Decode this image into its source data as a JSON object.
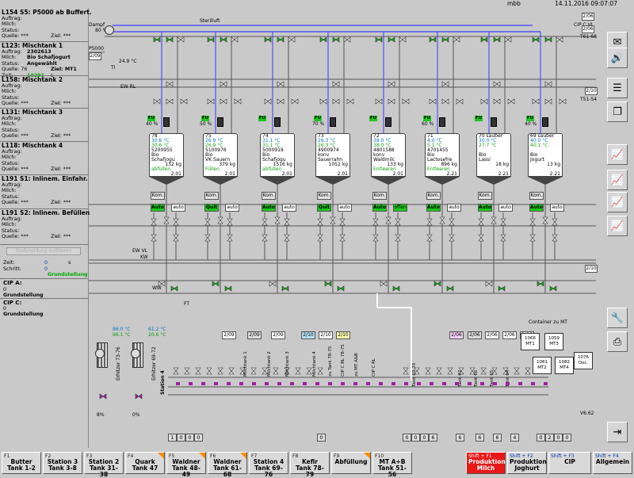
{
  "header": {
    "title": "",
    "user": "mbb",
    "datetime": "14.11.2016 09:07:07"
  },
  "left_panel": [
    {
      "title": "L154 S5: P5000 ab Buffert.",
      "rows": [
        [
          "Auftrag:",
          "",
          ""
        ],
        [
          "Milch:",
          "",
          ""
        ],
        [
          "Status:",
          "",
          ""
        ],
        [
          "Quelle: ***",
          "",
          "Ziel: ***"
        ],
        [
          "...",
          "",
          ""
        ]
      ]
    },
    {
      "title": "L123: Mischtank 1",
      "rows": [
        [
          "Auftrag:",
          "2302613",
          ""
        ],
        [
          "Milch:",
          "Bio Schafjogurt",
          ""
        ],
        [
          "Status:",
          "Angewählt",
          ""
        ],
        [
          "Quelle: 76",
          "",
          "Ziel: MT1"
        ],
        [
          "Zeit:",
          "10291",
          "s"
        ]
      ]
    },
    {
      "title": "L158: Mischtank 2",
      "rows": [
        [
          "Auftrag:",
          "",
          ""
        ],
        [
          "Milch:",
          "",
          ""
        ],
        [
          "Status:",
          "",
          ""
        ],
        [
          "Quelle: ***",
          "",
          "Ziel: ***"
        ]
      ]
    },
    {
      "title": "L131: Mischtank 3",
      "rows": [
        [
          "Auftrag:",
          "",
          ""
        ],
        [
          "Milch:",
          "",
          ""
        ],
        [
          "Status:",
          "",
          ""
        ],
        [
          "Quelle: ***",
          "",
          "Ziel: ***"
        ]
      ]
    },
    {
      "title": "L118: Mischtank 4",
      "rows": [
        [
          "Auftrag:",
          "",
          ""
        ],
        [
          "Milch:",
          "",
          ""
        ],
        [
          "Status:",
          "",
          ""
        ],
        [
          "Quelle: ***",
          "",
          "Ziel: ***"
        ]
      ]
    },
    {
      "title": "L191 S1: Inlinem. Einfahr.",
      "rows": [
        [
          "Auftrag:",
          "",
          ""
        ],
        [
          "Milch:",
          "",
          ""
        ],
        [
          "Status:",
          "",
          ""
        ],
        [
          "Quelle: ***",
          "",
          "Ziel: ***"
        ]
      ]
    },
    {
      "title": "L191 S2: Inlinem. Befüllen",
      "rows": [
        [
          "Auftrag:",
          "",
          ""
        ],
        [
          "Milch:",
          "",
          ""
        ],
        [
          "Status:",
          "",
          ""
        ],
        [
          "Quelle: ***",
          "",
          "Ziel: ***"
        ]
      ]
    }
  ],
  "misc": {
    "zeit_label": "Zeit:",
    "zeit_value": "0",
    "zeit_unit": "s",
    "schritt_label": "Schritt:",
    "schritt_value": "0",
    "schritt_text": "Grundstellung",
    "disabled_button": "Stoßmeldung quittieren",
    "cip_a": "CIP A:",
    "cip_a_val": "0",
    "cip_a_text": "Grundstellung",
    "cip_c": "CIP C:",
    "cip_c_val": "0",
    "cip_c_text": "Grundstellung"
  },
  "process": {
    "dampf": "Dampf",
    "steril": "Sterilluft",
    "p5000": "P5000",
    "p5000_box": "2/09",
    "dampf_pct": "80 %",
    "fu_label": "FU",
    "sw_label": "SW",
    "temp_main": "24.9 °C",
    "ti_label": "TI",
    "cip_c_vl": "CIP C VL",
    "t61_68": "T61-68",
    "t51_54": "T51-54",
    "ew_rl": "EW RL",
    "ew_vl": "EW VL",
    "kw": "KW",
    "ww": "WW",
    "ft": "FT",
    "cip_c_rl": "2/10",
    "tanks": [
      {
        "num": "78",
        "temp1": "30.6 °C",
        "temp2": "30.6 °C",
        "auftrag": "5200955",
        "name1": "Bio",
        "name2": "Schafjogu",
        "amount": "132 kg",
        "state": "abfüllen",
        "level": "2.01",
        "pct": "40 %",
        "mode": "Auto",
        "aux": "auto"
      },
      {
        "num": "75",
        "temp1": "26.9 °C",
        "temp2": "26.9 °C",
        "auftrag": "5100976",
        "name1": "Bio",
        "name2": "VK Sauern",
        "amount": "379 kg",
        "state": "Füllen",
        "level": "2.01",
        "pct": "50 %",
        "mode": "Quit",
        "aux": "auto"
      },
      {
        "num": "74",
        "temp1": "31.1 °C",
        "temp2": "31.1 °C",
        "auftrag": "5000919",
        "name1": "Bio",
        "name2": "Schafjogu",
        "amount": "1516 kg",
        "state": "abfüllen",
        "level": "2.01",
        "pct": "",
        "mode": "Auto",
        "aux": "auto"
      },
      {
        "num": "73",
        "temp1": "26.3 °C",
        "temp2": "26.3 °C",
        "auftrag": "4900974",
        "name1": "konv",
        "name2": "Sauerrahn",
        "amount": "1052 kg",
        "state": "",
        "level": "2.01",
        "pct": "70 %",
        "mode": "Quit",
        "aux": "auto"
      },
      {
        "num": "72",
        "temp1": "38.0 °C",
        "temp2": "38.0 °C",
        "auftrag": "4801588",
        "name1": "konv",
        "name2": "Waldmilc",
        "amount": "133 kg",
        "state": "Entleeren",
        "level": "2.01",
        "pct": "",
        "mode": "Auto",
        "aux": "offen"
      },
      {
        "num": "71",
        "temp1": "4.0 °C",
        "temp2": "5.1 °C",
        "auftrag": "4701455",
        "name1": "Bio",
        "name2": "Lactosefre",
        "amount": "896 kg",
        "state": "Entleeren",
        "level": "2.21",
        "pct": "60 %",
        "mode": "Auto",
        "aux": "auto"
      },
      {
        "num": "70 sauber",
        "temp1": "30.0 °C",
        "temp2": "27.7 °C",
        "auftrag": "",
        "name1": "Bio",
        "name2": "Lassi",
        "amount": "18 kg",
        "state": "",
        "level": "2.21",
        "pct": "",
        "mode": "Auto",
        "aux": "auto"
      },
      {
        "num": "69 sauber",
        "temp1": "40.0 °C",
        "temp2": "40.1 °C",
        "auftrag": "",
        "name1": "Bio",
        "name2": "Jogurt",
        "amount": "13 kg",
        "state": "",
        "level": "2.21",
        "pct": "40 %",
        "mode": "Auto",
        "aux": "auto"
      }
    ],
    "lower_temps": [
      {
        "label": "Erhitzer 73-76",
        "t1": "86.0 °C",
        "t2": "96.1 °C",
        "pct": "8%"
      },
      {
        "label": "Erhitzer 69-72",
        "t1": "61.2 °C",
        "t2": "20.6 °C",
        "pct": "0%"
      }
    ],
    "station": "Station 4",
    "tags": [
      "2/09",
      "2/09",
      "2/09",
      "2/10",
      "2/10",
      "2/10",
      "2/06",
      "2/06",
      "2/06",
      "2/06",
      "2/06"
    ],
    "vertical": [
      "Milchtank 1",
      "Milchtank 2",
      "Milchtank 3",
      "Milchtank 4",
      "zu Tank 78-75",
      "CIP C RL 78-75",
      "zu MT A&B",
      "CIP C RL",
      "Tank 69-70",
      "Tank 67",
      "Tank 66",
      "Tank 65",
      "Tank 64"
    ],
    "container": "Container zu MT",
    "mt": [
      "1066 MT1",
      "1059 MT3",
      "1081 MT2",
      "1082 MT4",
      "1076 Doc."
    ],
    "bottom_numbers": [
      "1",
      "0",
      "0",
      "0",
      "0",
      "0",
      "0",
      "0",
      "6",
      "6",
      "6",
      "6",
      "4",
      "0",
      "2",
      "0",
      "0"
    ],
    "version": "V6.62"
  },
  "fkeys": [
    {
      "n": "F1",
      "l1": "Butter",
      "l2": "Tank 1-2"
    },
    {
      "n": "F2",
      "l1": "Station 3",
      "l2": "Tank 3-8"
    },
    {
      "n": "F3",
      "l1": "Station 2",
      "l2": "Tank 31-38"
    },
    {
      "n": "F4",
      "l1": "Quark",
      "l2": "Tank 47"
    },
    {
      "n": "F5",
      "l1": "Waldner",
      "l2": "Tank 48-49"
    },
    {
      "n": "F6",
      "l1": "Waldner",
      "l2": "Tank 61-68"
    },
    {
      "n": "F7",
      "l1": "Station 4",
      "l2": "Tank 69-76"
    },
    {
      "n": "F8",
      "l1": "Kefir",
      "l2": "Tank 78-79"
    },
    {
      "n": "F9",
      "l1": "Abfüllung",
      "l2": ""
    },
    {
      "n": "F10",
      "l1": "MT A+B",
      "l2": "Tank 51-56"
    },
    {
      "n": "Shift + F1",
      "l1": "Produktion",
      "l2": "Milch"
    },
    {
      "n": "Shift + F2",
      "l1": "Produktion",
      "l2": "Joghurt"
    },
    {
      "n": "Shift + F3",
      "l1": "CIP",
      "l2": ""
    },
    {
      "n": "Shift + F4",
      "l1": "Allgemein",
      "l2": ""
    }
  ],
  "right_icons": [
    "message-icon",
    "speaker-icon",
    "list-icon",
    "copy-icon",
    "trend-icon",
    "trend-icon",
    "trend-icon",
    "trend-icon",
    "wrench-icon",
    "printer-icon",
    "exit-icon"
  ],
  "colors": {
    "pipe": "#4a4a4a",
    "valve_green": "#10b010",
    "steam": "#3c3cff",
    "active": "#1ec81e"
  }
}
